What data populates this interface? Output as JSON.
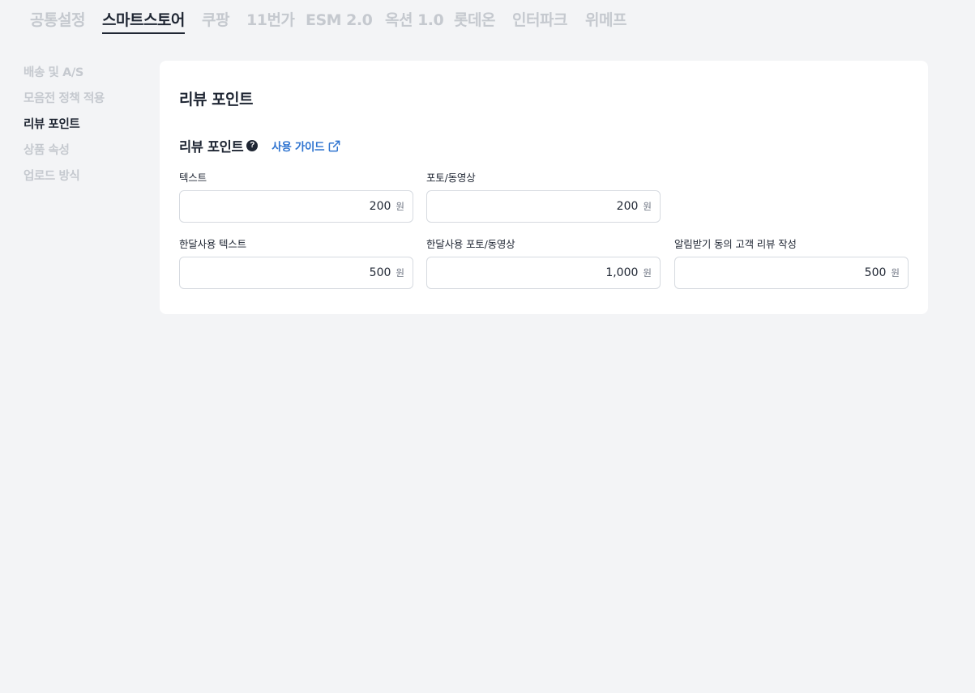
{
  "top_tabs": [
    {
      "label": "공통설정",
      "active": false
    },
    {
      "label": "스마트스토어",
      "active": true
    },
    {
      "label": "쿠팡",
      "active": false
    },
    {
      "label": "11번가",
      "active": false
    },
    {
      "label": "ESM 2.0",
      "active": false
    },
    {
      "label": "옥션 1.0",
      "active": false
    },
    {
      "label": "롯데온",
      "active": false
    },
    {
      "label": "인터파크",
      "active": false
    },
    {
      "label": "위메프",
      "active": false
    }
  ],
  "side_nav": [
    {
      "label": "배송 및 A/S",
      "active": false
    },
    {
      "label": "모음전 정책 적용",
      "active": false
    },
    {
      "label": "리뷰 포인트",
      "active": true
    },
    {
      "label": "상품 속성",
      "active": false
    },
    {
      "label": "업로드 방식",
      "active": false
    }
  ],
  "card": {
    "title": "리뷰 포인트",
    "section_title": "리뷰 포인트",
    "help_icon_glyph": "?",
    "guide_link_label": "사용 가이드",
    "fields": [
      {
        "label": "텍스트",
        "value": "200",
        "unit": "원"
      },
      {
        "label": "포토/동영상",
        "value": "200",
        "unit": "원"
      },
      {
        "label": "한달사용 텍스트",
        "value": "500",
        "unit": "원"
      },
      {
        "label": "한달사용 포토/동영상",
        "value": "1,000",
        "unit": "원"
      },
      {
        "label": "알림받기 동의 고객 리뷰 작성",
        "value": "500",
        "unit": "원"
      }
    ]
  },
  "colors": {
    "background": "#f3f4f6",
    "text_primary": "#1f2633",
    "text_muted": "#c5c9cf",
    "link": "#2f74d0",
    "card": "#ffffff",
    "input_border": "#d6dae0"
  }
}
